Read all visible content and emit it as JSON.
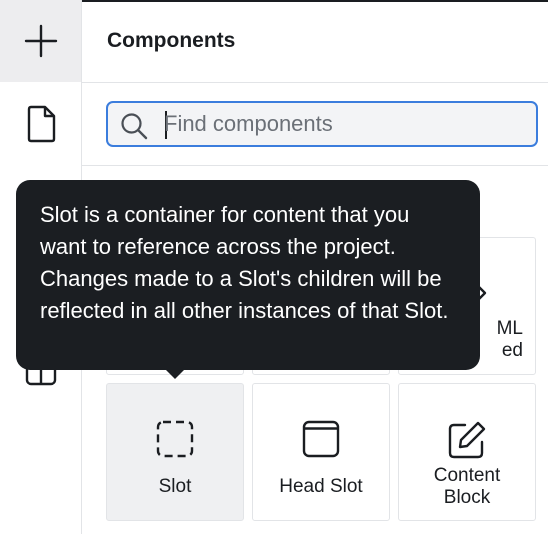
{
  "panel": {
    "title": "Components"
  },
  "search": {
    "placeholder": "Find components",
    "value": ""
  },
  "rail": {
    "items": [
      {
        "icon": "plus-icon"
      },
      {
        "icon": "page-icon"
      },
      {
        "icon": "layout-icon"
      }
    ]
  },
  "tiles": [
    {
      "label": "Slot",
      "icon": "slot-dashed-square-icon",
      "selected": true
    },
    {
      "label": "Head Slot",
      "icon": "head-slot-icon"
    },
    {
      "label": "Content Block",
      "label_lines": [
        "Content",
        "Block"
      ],
      "icon": "edit-pencil-icon"
    }
  ],
  "hidden_tile": {
    "label_lines": [
      "ML",
      "ed"
    ]
  },
  "tooltip": {
    "text": "Slot is a container for content that you want to reference across the project. Changes made to a Slot's children will be reflected in all other instances of that Slot."
  },
  "colors": {
    "accent": "#3b7ddd",
    "tooltip_bg": "#1b1e22",
    "selected_tile": "#eff0f2",
    "rail_active": "#ededef"
  }
}
